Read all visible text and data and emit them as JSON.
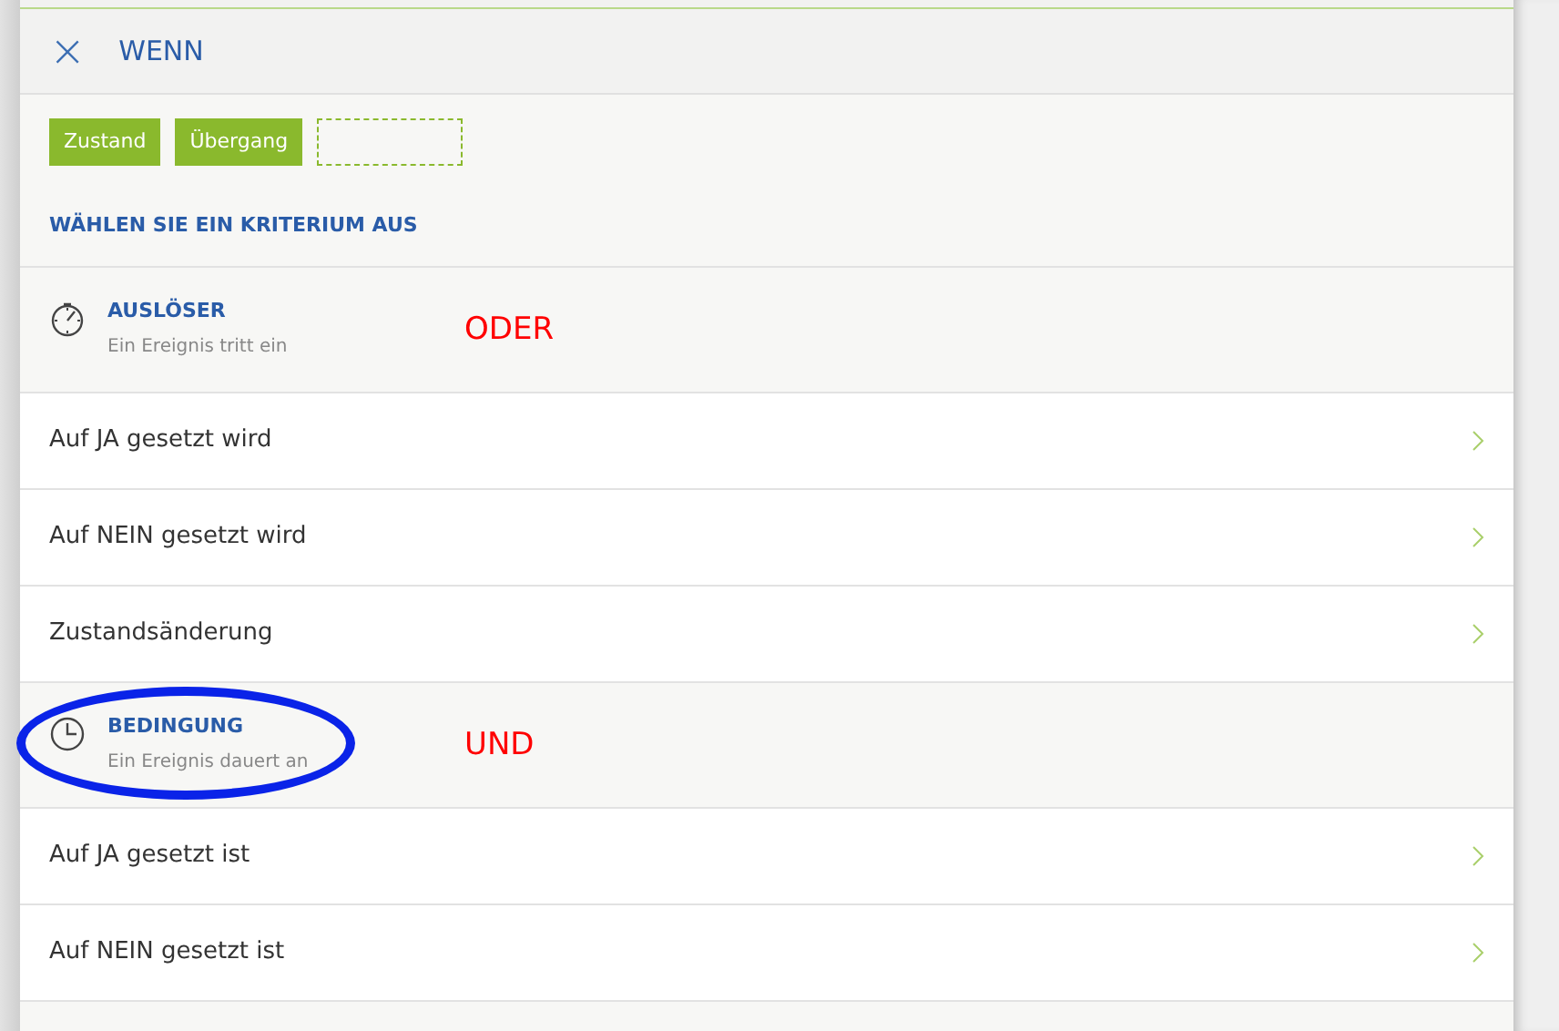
{
  "header": {
    "close": "×",
    "title": "WENN"
  },
  "chips": [
    {
      "kind": "button",
      "label": "Zustand"
    },
    {
      "kind": "button",
      "label": "Übergang"
    },
    {
      "kind": "slot"
    }
  ],
  "prompt": "WÄHLEN SIE EIN KRITERIUM AUS",
  "sections": [
    {
      "kind": "trigger",
      "title": "AUSLÖSER",
      "subtitle": "Ein Ereignis tritt ein",
      "annotation": "ODER",
      "circled": false,
      "items": [
        "Auf JA gesetzt wird",
        "Auf NEIN gesetzt wird",
        "Zustandsänderung"
      ]
    },
    {
      "kind": "condition",
      "title": "BEDINGUNG",
      "subtitle": "Ein Ereignis dauert an",
      "annotation": "UND",
      "circled": true,
      "items": [
        "Auf JA gesetzt ist",
        "Auf NEIN gesetzt ist"
      ]
    }
  ]
}
